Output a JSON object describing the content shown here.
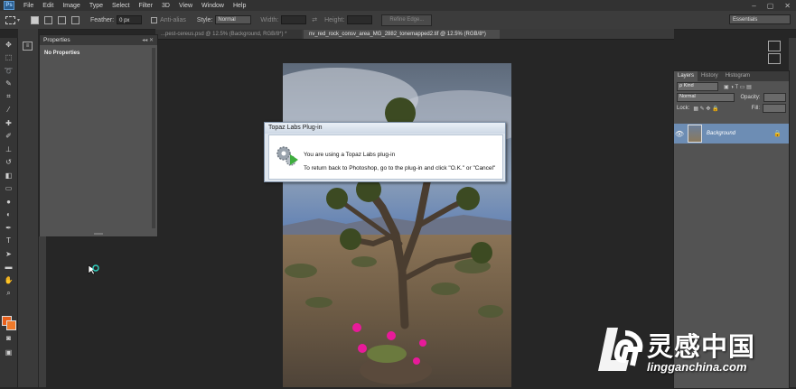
{
  "menubar": {
    "logo": "Ps",
    "items": [
      "File",
      "Edit",
      "Image",
      "Type",
      "Select",
      "Filter",
      "3D",
      "View",
      "Window",
      "Help"
    ],
    "window_controls": [
      "–",
      "▢",
      "✕"
    ]
  },
  "options_bar": {
    "feather_label": "Feather:",
    "feather_value": "0 px",
    "anti_alias_label": "Anti-alias",
    "style_label": "Style:",
    "style_value": "Normal",
    "width_label": "Width:",
    "height_label": "Height:",
    "refine_edge_label": "Refine Edge...",
    "workspace_value": "Essentials"
  },
  "tabs": [
    {
      "label": "...pest-cereus.psd @ 12.5% (Background, RGB/8*) *",
      "active": false
    },
    {
      "label": "nv_red_rock_consv_area_MG_2882_tonemapped2.tif @ 12.5% (RGB/8*)",
      "active": true
    }
  ],
  "properties_panel": {
    "title": "Properties",
    "body": "No Properties"
  },
  "dialog": {
    "title": "Topaz Labs Plug-in",
    "line1": "You are using a Topaz Labs plug-in",
    "line2": "To return back to Photoshop, go to the plug-in and click \"O.K.\" or \"Cancel\""
  },
  "layers_panel": {
    "tabs": [
      "Layers",
      "History",
      "Histogram"
    ],
    "kind_label": "Kind",
    "blend_mode": "Normal",
    "opacity_label": "Opacity:",
    "lock_label": "Lock:",
    "fill_label": "Fill:",
    "layer_name": "Background"
  },
  "watermark": {
    "chinese": "灵感中国",
    "url": "lingganchina.com"
  },
  "colors": {
    "foreground": "#e8601c",
    "background": "#ef7a2a",
    "layer_selected": "#6d8db4"
  }
}
